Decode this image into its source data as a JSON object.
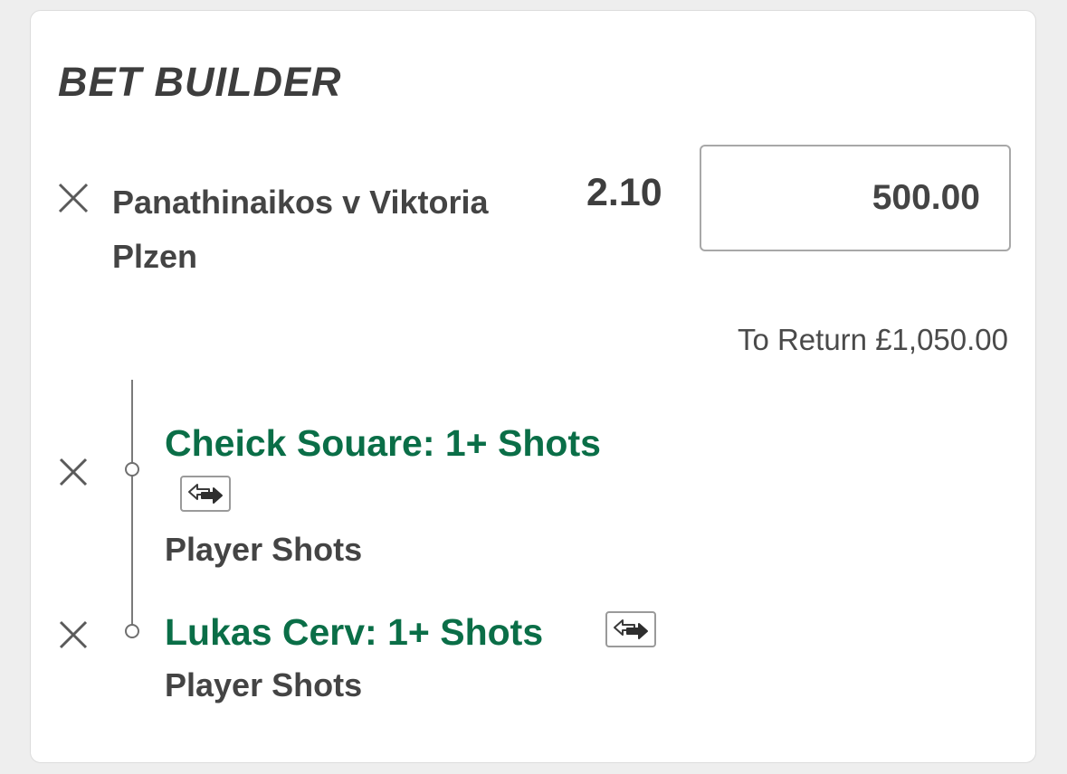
{
  "header": {
    "title": "BET BUILDER"
  },
  "bet": {
    "event_line1": "Panathinaikos v Viktoria",
    "event_line2": "Plzen",
    "odds": "2.10",
    "stake_value": "500.00",
    "to_return": "To Return £1,050.00"
  },
  "selections": [
    {
      "name": "Cheick Souare: 1+ Shots",
      "market": "Player Shots"
    },
    {
      "name": "Lukas Cerv: 1+ Shots",
      "market": "Player Shots"
    }
  ],
  "icons": {
    "remove": "close-icon",
    "swap": "swap-arrows-icon"
  },
  "colors": {
    "selection_green": "#0a6e47",
    "text_dark": "#444444"
  }
}
